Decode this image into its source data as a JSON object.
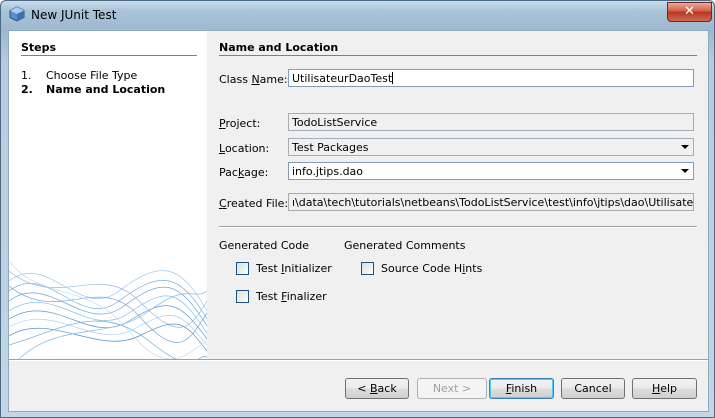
{
  "window": {
    "title": "New JUnit Test",
    "close_glyph": "✕"
  },
  "steps": {
    "title": "Steps",
    "items": [
      {
        "num": "1.",
        "label": "Choose File Type"
      },
      {
        "num": "2.",
        "label": "Name and Location"
      }
    ]
  },
  "section": {
    "title": "Name and Location"
  },
  "form": {
    "class_name": {
      "label_pre": "Class ",
      "label_mn": "N",
      "label_post": "ame:",
      "value": "UtilisateurDaoTest"
    },
    "project": {
      "label_mn": "P",
      "label_post": "roject:",
      "value": "TodoListService"
    },
    "location": {
      "label_mn": "L",
      "label_post": "ocation:",
      "value": "Test Packages"
    },
    "package": {
      "label_pre": "Pac",
      "label_mn": "k",
      "label_post": "age:",
      "value": "info.jtips.dao"
    },
    "created_file": {
      "label_mn": "C",
      "label_post": "reated File:",
      "value": "ı\\data\\tech\\tutorials\\netbeans\\TodoListService\\test\\info\\jtips\\dao\\UtilisateurDaoTes"
    }
  },
  "generated_code": {
    "label": "Generated Code",
    "test_initializer": {
      "label_pre": "Test ",
      "label_mn": "I",
      "label_post": "nitializer",
      "checked": false
    },
    "test_finalizer": {
      "label_pre": "Test ",
      "label_mn": "F",
      "label_post": "inalizer",
      "checked": false
    }
  },
  "generated_comments": {
    "label": "Generated Comments",
    "source_code_hints": {
      "label_pre": "Source Code H",
      "label_mn": "i",
      "label_post": "nts",
      "checked": false
    }
  },
  "buttons": {
    "back": {
      "pre": "< ",
      "mn": "B",
      "post": "ack"
    },
    "next": "Next >",
    "finish": {
      "mn": "F",
      "post": "inish"
    },
    "cancel": "Cancel",
    "help": {
      "mn": "H",
      "post": "elp"
    }
  },
  "colors": {
    "title_gradient": "#a9c3d8",
    "close_button": "#c8452e",
    "dialog_bg": "#f0f0f0",
    "default_button_border": "#3c7fb1"
  }
}
